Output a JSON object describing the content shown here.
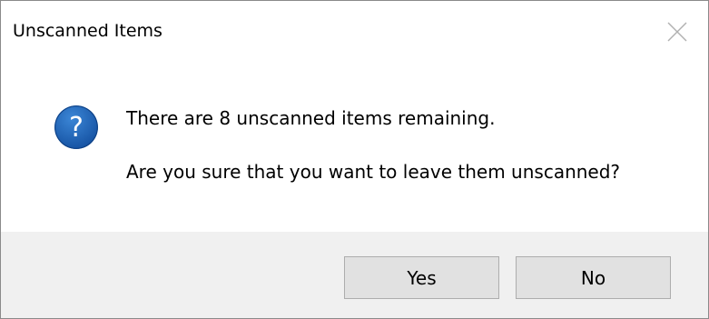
{
  "dialog": {
    "title": "Unscanned Items",
    "icon": "question-icon",
    "icon_color": "#1f5fae",
    "close_icon": "close-icon",
    "message_line1": "There are 8 unscanned items remaining.",
    "message_line2": "Are you sure that you want to leave them unscanned?",
    "buttons": {
      "yes_label": "Yes",
      "no_label": "No"
    }
  },
  "colors": {
    "footer_background": "#f0f0f0",
    "button_background": "#e1e1e1",
    "button_border": "#adadad"
  }
}
